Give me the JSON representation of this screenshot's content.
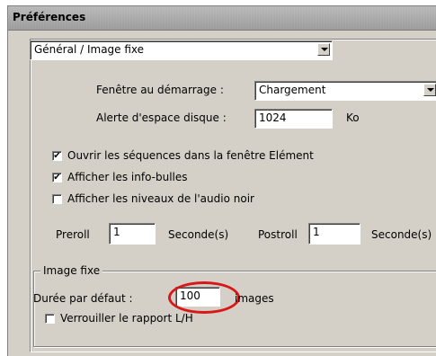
{
  "window": {
    "title": "Préférences"
  },
  "category_select": {
    "value": "Général / Image fixe"
  },
  "startup": {
    "label": "Fenêtre au démarrage :",
    "value": "Chargement"
  },
  "disk_alert": {
    "label": "Alerte d'espace disque :",
    "value": "1024",
    "unit": "Ko"
  },
  "checkboxes": [
    {
      "label": "Ouvrir les séquences dans la fenêtre Elément",
      "checked": true,
      "mark": "✔"
    },
    {
      "label": "Afficher les info-bulles",
      "checked": true,
      "mark": "✔"
    },
    {
      "label": "Afficher les niveaux de l'audio noir",
      "checked": false,
      "mark": ""
    }
  ],
  "preroll": {
    "label": "Preroll",
    "value": "1",
    "unit": "Seconde(s)"
  },
  "postroll": {
    "label": "Postroll",
    "value": "1",
    "unit": "Seconde(s)"
  },
  "still_image": {
    "group_title": "Image fixe",
    "duration_label": "Durée par défaut :",
    "duration_value": "100",
    "duration_unit": "images",
    "lock_aspect": {
      "label": "Verrouiller le rapport L/H",
      "checked": false,
      "mark": ""
    }
  },
  "colors": {
    "highlight_ring": "#d81818",
    "dialog_bg": "#d4d0c8"
  }
}
